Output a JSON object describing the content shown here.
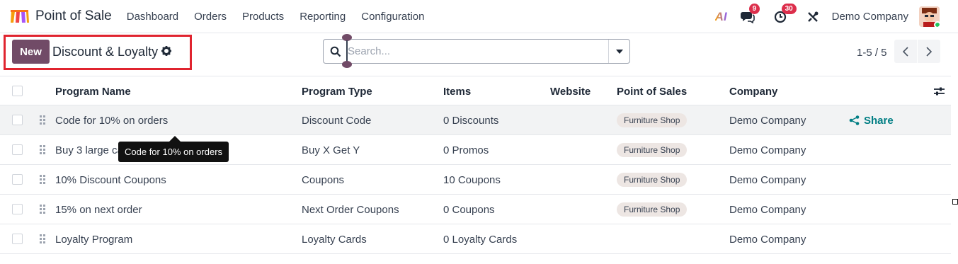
{
  "navbar": {
    "app_name": "Point of Sale",
    "menu": [
      "Dashboard",
      "Orders",
      "Products",
      "Reporting",
      "Configuration"
    ],
    "ai_label": "AI",
    "messages_badge": "9",
    "activities_badge": "30",
    "company": "Demo Company"
  },
  "control": {
    "new_label": "New",
    "title": "Discount & Loyalty",
    "search_placeholder": "Search...",
    "pager": "1-5 / 5"
  },
  "table": {
    "columns": [
      "Program Name",
      "Program Type",
      "Items",
      "Website",
      "Point of Sales",
      "Company"
    ],
    "rows": [
      {
        "name": "Code for 10% on orders",
        "type": "Discount Code",
        "items": "0 Discounts",
        "website": "",
        "pos": "Furniture Shop",
        "company": "Demo Company",
        "share": "Share"
      },
      {
        "name": "Buy 3 large ca",
        "type": "Buy X Get Y",
        "items": "0 Promos",
        "website": "",
        "pos": "Furniture Shop",
        "company": "Demo Company",
        "share": ""
      },
      {
        "name": "10% Discount Coupons",
        "type": "Coupons",
        "items": "10 Coupons",
        "website": "",
        "pos": "Furniture Shop",
        "company": "Demo Company",
        "share": ""
      },
      {
        "name": "15% on next order",
        "type": "Next Order Coupons",
        "items": "0 Coupons",
        "website": "",
        "pos": "Furniture Shop",
        "company": "Demo Company",
        "share": ""
      },
      {
        "name": "Loyalty Program",
        "type": "Loyalty Cards",
        "items": "0 Loyalty Cards",
        "website": "",
        "pos": "",
        "company": "Demo Company",
        "share": ""
      }
    ]
  },
  "tooltip": "Code for 10% on orders",
  "colors": {
    "primary": "#714b67",
    "highlight_box": "#e0242f",
    "share": "#017e84",
    "badge": "#dc2e4b",
    "tag_bg": "#ede6e3"
  }
}
